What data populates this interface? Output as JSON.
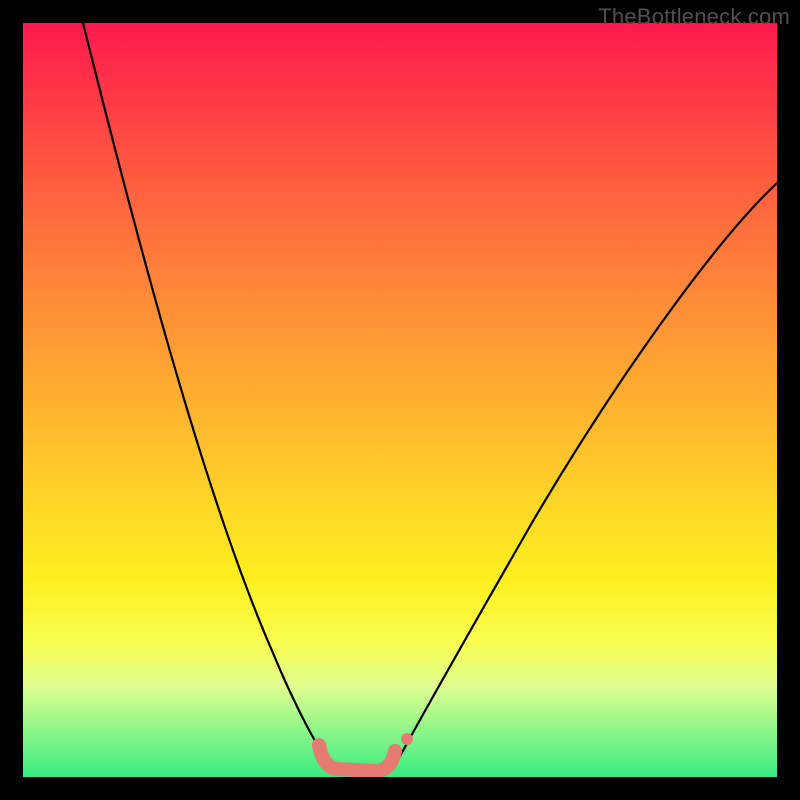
{
  "watermark": "TheBottleneck.com",
  "chart_data": {
    "type": "line",
    "title": "",
    "xlabel": "",
    "ylabel": "",
    "xlim": [
      0,
      100
    ],
    "ylim": [
      0,
      100
    ],
    "series": [
      {
        "name": "left-curve",
        "x": [
          8,
          12,
          16,
          20,
          24,
          28,
          32,
          35,
          38,
          40
        ],
        "y": [
          100,
          85,
          68,
          52,
          38,
          25,
          14,
          7,
          3,
          1
        ]
      },
      {
        "name": "right-curve",
        "x": [
          50,
          54,
          60,
          68,
          78,
          90,
          100
        ],
        "y": [
          1,
          5,
          14,
          28,
          46,
          65,
          79
        ]
      },
      {
        "name": "bottom-marker",
        "x": [
          38,
          40,
          42,
          44,
          46,
          48,
          50
        ],
        "y": [
          3,
          1,
          0.5,
          0.5,
          0.5,
          1,
          3
        ]
      }
    ],
    "gradient_background": {
      "top": "#ff1a4d",
      "mid": "#fff020",
      "bottom": "#37ec80"
    }
  }
}
